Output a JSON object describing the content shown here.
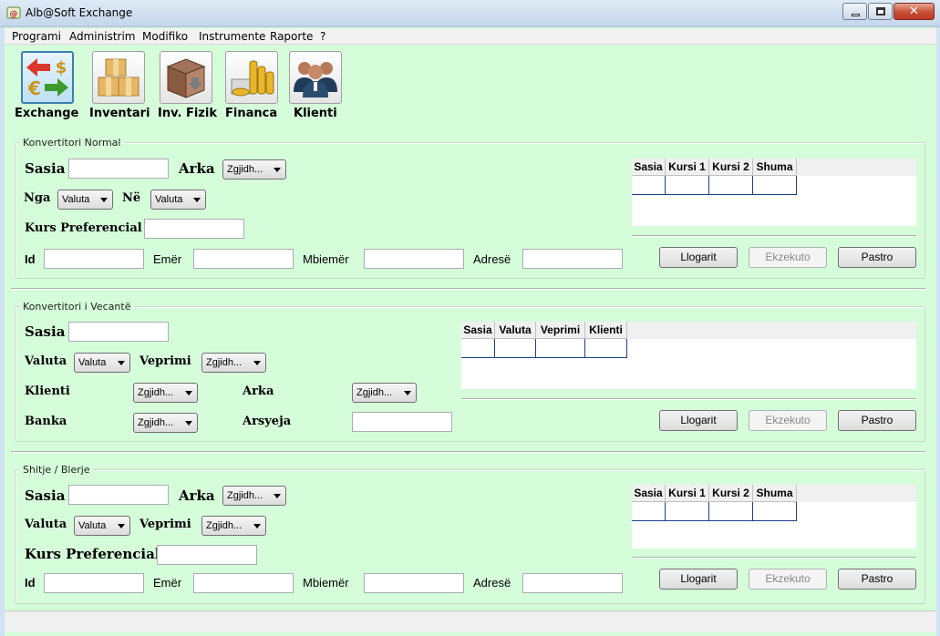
{
  "window": {
    "title": "Alb@Soft Exchange",
    "close_glyph": "✕"
  },
  "menu": [
    "Programi",
    "Administrim",
    "Modifiko",
    "Instrumente",
    "Raporte",
    "?"
  ],
  "toolbar": [
    {
      "label": "Exchange",
      "icon": "currency-exchange-icon"
    },
    {
      "label": "Inventari",
      "icon": "boxes-icon"
    },
    {
      "label": "Inv. Fizik",
      "icon": "box-download-icon"
    },
    {
      "label": "Financa",
      "icon": "coins-icon"
    },
    {
      "label": "Klienti",
      "icon": "people-icon"
    }
  ],
  "combo_default": "Zgjidh...",
  "buttons": {
    "calc": "Llogarit",
    "exec": "Ekzekuto",
    "clear": "Pastro"
  },
  "section1": {
    "title": "Konvertitori Normal",
    "sasia": "Sasia",
    "arka": "Arka",
    "nga": "Nga",
    "ne": "Në",
    "valuta_default": "Valuta",
    "kurs_pref": "Kurs Preferencial",
    "id": "Id",
    "emer": "Emër",
    "mbiemer": "Mbiemër",
    "adrese": "Adresë",
    "grid_headers": [
      "Sasia",
      "Kursi 1",
      "Kursi 2",
      "Shuma"
    ]
  },
  "section2": {
    "title": "Konvertitori i Vecantë",
    "sasia": "Sasia",
    "valuta": "Valuta",
    "valuta_default": "Valuta",
    "veprimi": "Veprimi",
    "klienti": "Klienti",
    "arka": "Arka",
    "banka": "Banka",
    "arsyeja": "Arsyeja",
    "grid_headers": [
      "Sasia",
      "Valuta",
      "Veprimi",
      "Klienti"
    ]
  },
  "section3": {
    "title": "Shitje / Blerje",
    "sasia": "Sasia",
    "arka": "Arka",
    "valuta": "Valuta",
    "valuta_default": "Valuta",
    "veprimi": "Veprimi",
    "kurs_pref": "Kurs Preferencial",
    "id": "Id",
    "emer": "Emër",
    "mbiemer": "Mbiemër",
    "adrese": "Adresë",
    "grid_headers": [
      "Sasia",
      "Kursi 1",
      "Kursi 2",
      "Shuma"
    ]
  }
}
